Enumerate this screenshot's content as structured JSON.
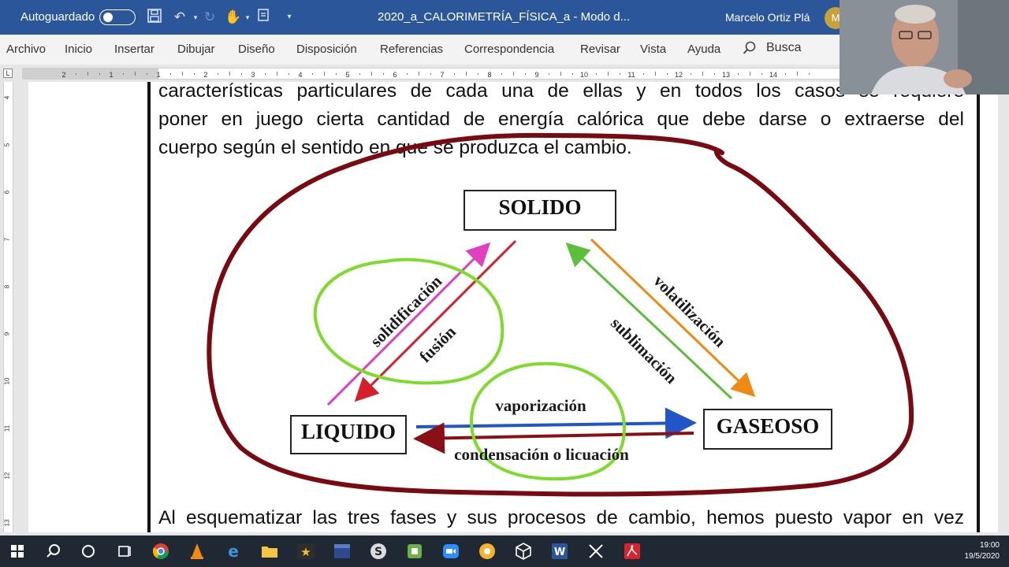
{
  "titlebar": {
    "autosave_label": "Autoguardado",
    "document_title": "2020_a_CALORIMETRÍA_FÍSICA_a  -  Modo d...",
    "user_name": "Marcelo  Ortiz Plá",
    "user_initial": "M"
  },
  "ribbon_tabs": [
    "Archivo",
    "Inicio",
    "Insertar",
    "Dibujar",
    "Diseño",
    "Disposición",
    "Referencias",
    "Correspondencia",
    "Revisar",
    "Vista",
    "Ayuda"
  ],
  "search": {
    "label": "Busca"
  },
  "ruler": {
    "corner": "L",
    "top_numbers": [
      "2",
      "1",
      "1",
      "2",
      "3",
      "4",
      "5",
      "6",
      "7",
      "8",
      "9",
      "10",
      "11",
      "12",
      "13",
      "14"
    ],
    "side_numbers": [
      "4",
      "5",
      "6",
      "7",
      "8",
      "9",
      "10",
      "11",
      "12",
      "13"
    ]
  },
  "document": {
    "lines_top": [
      "características particulares de cada una de ellas y en todos los casos se requiere",
      "poner en juego cierta cantidad de energía calórica que debe darse o extraerse del",
      "cuerpo según el sentido en que se produzca el cambio."
    ],
    "line_bottom": "Al esquematizar las tres fases y sus procesos de cambio, hemos puesto vapor en vez"
  },
  "diagram": {
    "states": {
      "solid": "SOLIDO",
      "liquid": "LIQUIDO",
      "gas": "GASEOSO"
    },
    "processes": {
      "solidification": "solidificación",
      "fusion": "fusión",
      "volatilization": "volatilización",
      "sublimation": "sublimación",
      "vaporization": "vaporización",
      "condensation": "condensación o licuación"
    },
    "colors": {
      "annotation_outline": "#7a0a12",
      "highlight_circle": "#7ddc2a",
      "arrow_pink": "#e23fc0",
      "arrow_red": "#d61f2a",
      "arrow_green": "#5cbf3a",
      "arrow_orange": "#f08a12",
      "arrow_blue": "#2255c8",
      "arrow_darkred": "#8a1016"
    }
  },
  "taskbar": {
    "icons": [
      "windows-start",
      "search",
      "cortana",
      "task-view",
      "chrome",
      "vlc",
      "edge",
      "file-explorer",
      "app-star",
      "dev-app",
      "skype",
      "android-studio",
      "zoom",
      "chrome-canary",
      "3d-app",
      "word",
      "snipping-tool",
      "acrobat"
    ],
    "time": "19:00",
    "date": "19/5/2020"
  }
}
